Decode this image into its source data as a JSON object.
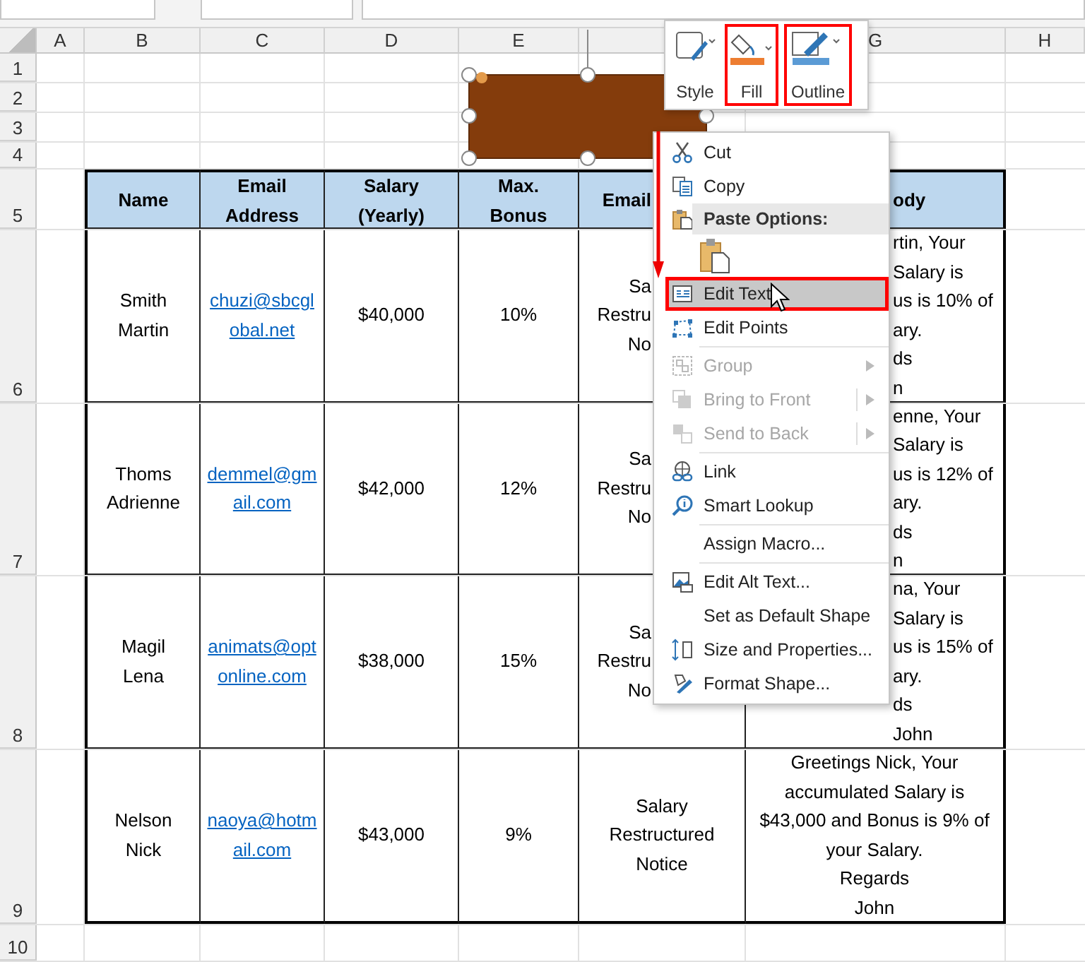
{
  "column_headers": [
    "A",
    "B",
    "C",
    "D",
    "E",
    "G",
    "H"
  ],
  "row_headers": [
    "1",
    "2",
    "3",
    "4",
    "5",
    "6",
    "7",
    "8",
    "9",
    "10"
  ],
  "table": {
    "columns": [
      {
        "label": "Name",
        "under_menu": false
      },
      {
        "label": "Email Address",
        "under_menu": false
      },
      {
        "label": "Salary (Yearly)",
        "under_menu": false
      },
      {
        "label": "Max. Bonus",
        "under_menu": false
      },
      {
        "label": "Email",
        "under_menu": true
      },
      {
        "label": "ody",
        "under_menu": true
      }
    ],
    "rows": [
      {
        "name": "Smith Martin",
        "email": "chuzi@sbcglobal.net",
        "salary": "$40,000",
        "bonus": "10%",
        "under_menu": true,
        "subject_lines": [
          "Sa",
          "Restru",
          "No"
        ],
        "body_lines": [
          "rtin, Your",
          "Salary is",
          "us is 10% of",
          "ary.",
          "ds",
          "n"
        ]
      },
      {
        "name": "Thoms Adrienne",
        "email": "demmel@gmail.com",
        "salary": "$42,000",
        "bonus": "12%",
        "under_menu": true,
        "subject_lines": [
          "Sa",
          "Restru",
          "No"
        ],
        "body_lines": [
          "enne, Your",
          "Salary is",
          "us is 12% of",
          "ary.",
          "ds",
          "n"
        ]
      },
      {
        "name": "Magil Lena",
        "email": "animats@optonline.com",
        "salary": "$38,000",
        "bonus": "15%",
        "under_menu": true,
        "subject_lines": [
          "Sa",
          "Restru",
          "No"
        ],
        "body_lines": [
          "na, Your",
          "Salary is",
          "us is 15% of",
          "ary.",
          "ds",
          "John"
        ]
      },
      {
        "name": "Nelson Nick",
        "email": "naoya@hotmail.com",
        "salary": "$43,000",
        "bonus": "9%",
        "under_menu": false,
        "subject_lines": [
          "Salary",
          "Restructured",
          "Notice"
        ],
        "body_lines": [
          "Greetings Nick, Your",
          "accumulated Salary is",
          "$43,000 and Bonus is 9% of",
          "your Salary.",
          "Regards",
          "John"
        ]
      }
    ]
  },
  "mini_toolbar": {
    "buttons": [
      {
        "label": "Style",
        "highlighted": false
      },
      {
        "label": "Fill",
        "highlighted": true
      },
      {
        "label": "Outline",
        "highlighted": true
      }
    ]
  },
  "context_menu": {
    "groups": [
      [
        {
          "kind": "command",
          "label": "Cut",
          "disabled": false,
          "submenu": false,
          "selected": false,
          "highlighted": false
        },
        {
          "kind": "command",
          "label": "Copy",
          "disabled": false,
          "submenu": false,
          "selected": false,
          "highlighted": false
        },
        {
          "kind": "header",
          "label": "Paste Options:"
        },
        {
          "kind": "paste_buttons"
        },
        {
          "kind": "command",
          "label": "Edit Text",
          "disabled": false,
          "submenu": false,
          "selected": true,
          "highlighted": true
        },
        {
          "kind": "command",
          "label": "Edit Points",
          "disabled": false,
          "submenu": false,
          "selected": false,
          "highlighted": false
        }
      ],
      [
        {
          "kind": "command",
          "label": "Group",
          "disabled": true,
          "submenu": true,
          "split": false,
          "selected": false,
          "highlighted": false
        },
        {
          "kind": "command",
          "label": "Bring to Front",
          "disabled": true,
          "submenu": true,
          "split": true,
          "selected": false,
          "highlighted": false
        },
        {
          "kind": "command",
          "label": "Send to Back",
          "disabled": true,
          "submenu": true,
          "split": true,
          "selected": false,
          "highlighted": false
        }
      ],
      [
        {
          "kind": "command",
          "label": "Link",
          "disabled": false,
          "submenu": false,
          "selected": false,
          "highlighted": false
        },
        {
          "kind": "command",
          "label": "Smart Lookup",
          "disabled": false,
          "submenu": false,
          "selected": false,
          "highlighted": false
        }
      ],
      [
        {
          "kind": "command",
          "label": "Assign Macro...",
          "disabled": false,
          "submenu": false,
          "selected": false,
          "highlighted": false
        }
      ],
      [
        {
          "kind": "command",
          "label": "Edit Alt Text...",
          "disabled": false,
          "submenu": false,
          "selected": false,
          "highlighted": false
        },
        {
          "kind": "command",
          "label": "Set as Default Shape",
          "disabled": false,
          "submenu": false,
          "selected": false,
          "highlighted": false
        },
        {
          "kind": "command",
          "label": "Size and Properties...",
          "disabled": false,
          "submenu": false,
          "selected": false,
          "highlighted": false
        },
        {
          "kind": "command",
          "label": "Format Shape...",
          "disabled": false,
          "submenu": false,
          "selected": false,
          "highlighted": false
        }
      ]
    ]
  }
}
